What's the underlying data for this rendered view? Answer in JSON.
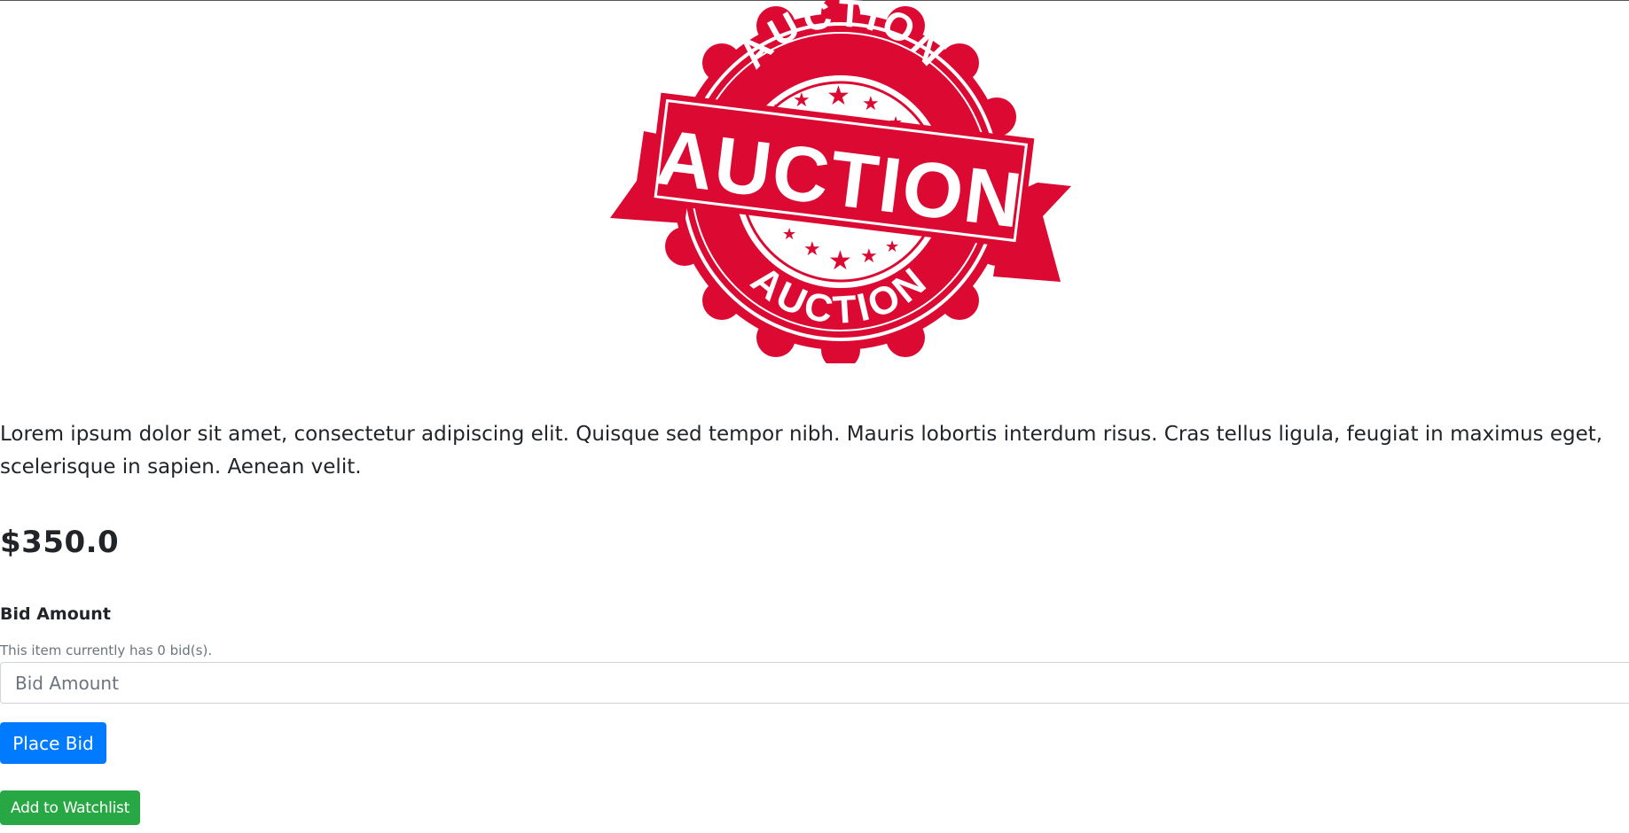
{
  "logo": {
    "top_text": "AUCTION",
    "banner_text": "AUCTION",
    "bottom_text": "AUCTION",
    "color": "#dc0a32"
  },
  "listing": {
    "description": "Lorem ipsum dolor sit amet, consectetur adipiscing elit. Quisque sed tempor nibh. Mauris lobortis interdum risus. Cras tellus ligula, feugiat in maximus eget, scelerisque in sapien. Aenean velit.",
    "price": "$350.0"
  },
  "bid_form": {
    "label": "Bid Amount",
    "help_text": "This item currently has 0 bid(s).",
    "input_placeholder": "Bid Amount",
    "input_value": "",
    "submit_label": "Place Bid"
  },
  "watchlist": {
    "button_label": "Add to Watchlist"
  },
  "colors": {
    "primary": "#007bff",
    "success": "#28a745",
    "text": "#212529",
    "muted": "#6c757d"
  }
}
